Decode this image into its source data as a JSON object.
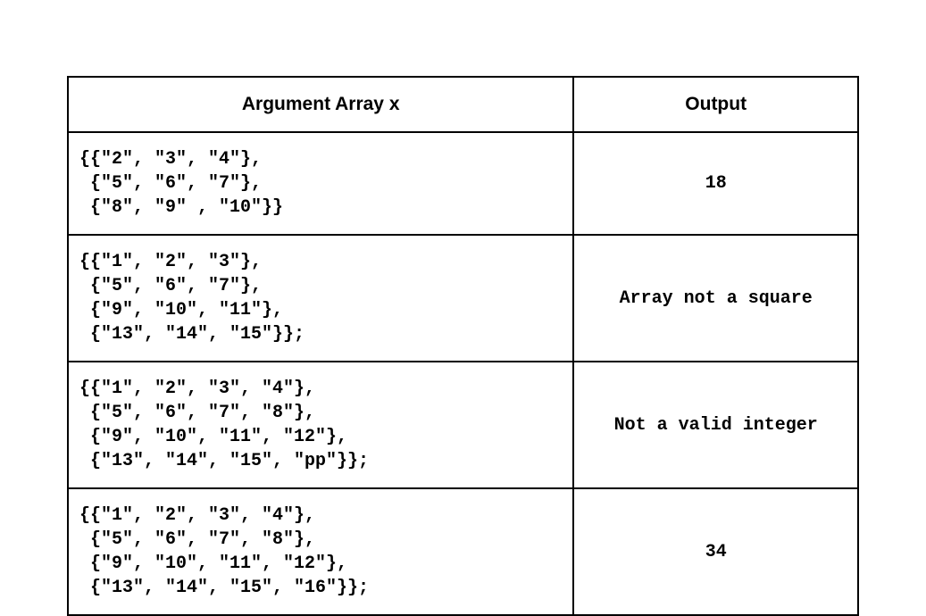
{
  "chart_data": {
    "type": "table",
    "headers": [
      "Argument Array x",
      "Output"
    ],
    "rows": [
      {
        "input": "{{\"2\", \"3\", \"4\"},\n {\"5\", \"6\", \"7\"},\n {\"8\", \"9\" , \"10\"}}",
        "output": "18"
      },
      {
        "input": "{{\"1\", \"2\", \"3\"},\n {\"5\", \"6\", \"7\"},\n {\"9\", \"10\", \"11\"},\n {\"13\", \"14\", \"15\"}};",
        "output": "Array not a square"
      },
      {
        "input": "{{\"1\", \"2\", \"3\", \"4\"},\n {\"5\", \"6\", \"7\", \"8\"},\n {\"9\", \"10\", \"11\", \"12\"},\n {\"13\", \"14\", \"15\", \"pp\"}};",
        "output": "Not a valid integer"
      },
      {
        "input": "{{\"1\", \"2\", \"3\", \"4\"},\n {\"5\", \"6\", \"7\", \"8\"},\n {\"9\", \"10\", \"11\", \"12\"},\n {\"13\", \"14\", \"15\", \"16\"}};",
        "output": "34"
      }
    ]
  }
}
